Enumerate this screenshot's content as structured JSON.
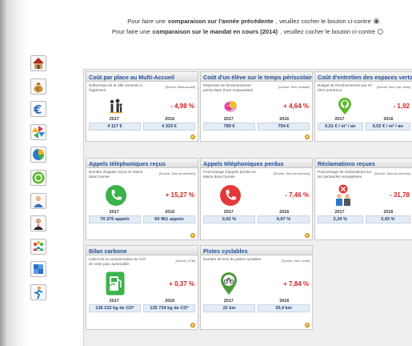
{
  "header": {
    "line1_pre": "Pour faire une",
    "line1_bold": "comparaison sur l'année précédente",
    "line1_post": ", veuillez cocher le bouton ci-contre",
    "line1_selected": true,
    "line2_pre": "Pour faire une",
    "line2_bold": "comparaison sur le mandat en cours (2014)",
    "line2_post": ", veuillez cocher le bouton ci-contre",
    "line2_selected": false
  },
  "sidebar": {
    "icons": [
      {
        "name": "house-icon"
      },
      {
        "name": "money-bag-icon"
      },
      {
        "name": "euro-icon"
      },
      {
        "name": "pinwheel-icon"
      },
      {
        "name": "pie-chart-icon"
      },
      {
        "name": "recycle-icon"
      },
      {
        "name": "person-icon"
      },
      {
        "name": "person-tie-icon"
      },
      {
        "name": "people-icon"
      },
      {
        "name": "puzzle-icon"
      },
      {
        "name": "runner-icon"
      }
    ]
  },
  "cards": [
    {
      "title": "Coût par place au Multi-Accueil",
      "desc": "Subvention de la ville ramenée à l'agrément",
      "source": "[Source: Multi-accueil]",
      "icon": "family-icon",
      "change": "- 4,98 %",
      "year1": "2017",
      "year2": "2016",
      "val1": "4 117 €",
      "val2": "4 333 €"
    },
    {
      "title": "Coût d'un élève sur le temps périscolaire",
      "desc": "Dépenses de fonctionnement périscolaire (hors restauration)",
      "source": "[Source: Serv. scolaire]",
      "icon": "theater-mask-icon",
      "change": "+ 4,64 %",
      "year1": "2017",
      "year2": "2016",
      "val1": "789 €",
      "val2": "754 €"
    },
    {
      "title": "Coût d'entretien des espaces verts",
      "desc": "Budget de fonctionnement par m² d'EV entretenu",
      "source": "[Source: Serv. esp. verts]",
      "icon": "tree-pin-icon",
      "change": "- 1,92",
      "year1": "2017",
      "year2": "2016",
      "val1": "0,51 € / m² / an",
      "val2": "0,52 € / m² / an"
    },
    {
      "title": "Appels téléphoniques reçus",
      "desc": "Nombre d'appels reçus en Mairie dans l'année",
      "source": "[Source: Tous les services]",
      "icon": "phone-green-icon",
      "change": "+ 15,27 %",
      "year1": "2017",
      "year2": "2016",
      "val1": "70 270 appels",
      "val2": "60 961 appels"
    },
    {
      "title": "Appels téléphoniques perdus",
      "desc": "Pourcentage d'appels perdus en Mairie dans l'année",
      "source": "[Source: Tous les services]",
      "icon": "phone-red-icon",
      "change": "- 7,46 %",
      "year1": "2017",
      "year2": "2016",
      "val1": "0,62 %",
      "val2": "0,67 %"
    },
    {
      "title": "Réclamations reçues",
      "desc": "Pourcentage de réclamations sur les demandes enregistrées",
      "source": "[Source: Tous les services]",
      "icon": "complaint-icon",
      "change": "- 31,78",
      "year1": "2017",
      "year2": "2016",
      "val1": "2,34 %",
      "val2": "3,43 %"
    },
    {
      "title": "Bilan carbone",
      "desc": "Calcul de la consommation de CO² de notre parc automobile",
      "source": "[Source: CTM]",
      "icon": "fuel-pump-icon",
      "change": "+ 0,37 %",
      "year1": "2017",
      "year2": "2016",
      "val1": "136 232 kg de CO²",
      "val2": "135 734 kg de CO²"
    },
    {
      "title": "Pistes cyclables",
      "desc": "Nombre de kms de pistes cyclables",
      "source": "[Source: Serv. voirie]",
      "icon": "bicycle-pin-icon",
      "change": "+ 7,84 %",
      "year1": "2017",
      "year2": "2016",
      "val1": "22 km",
      "val2": "20,4 km"
    }
  ]
}
